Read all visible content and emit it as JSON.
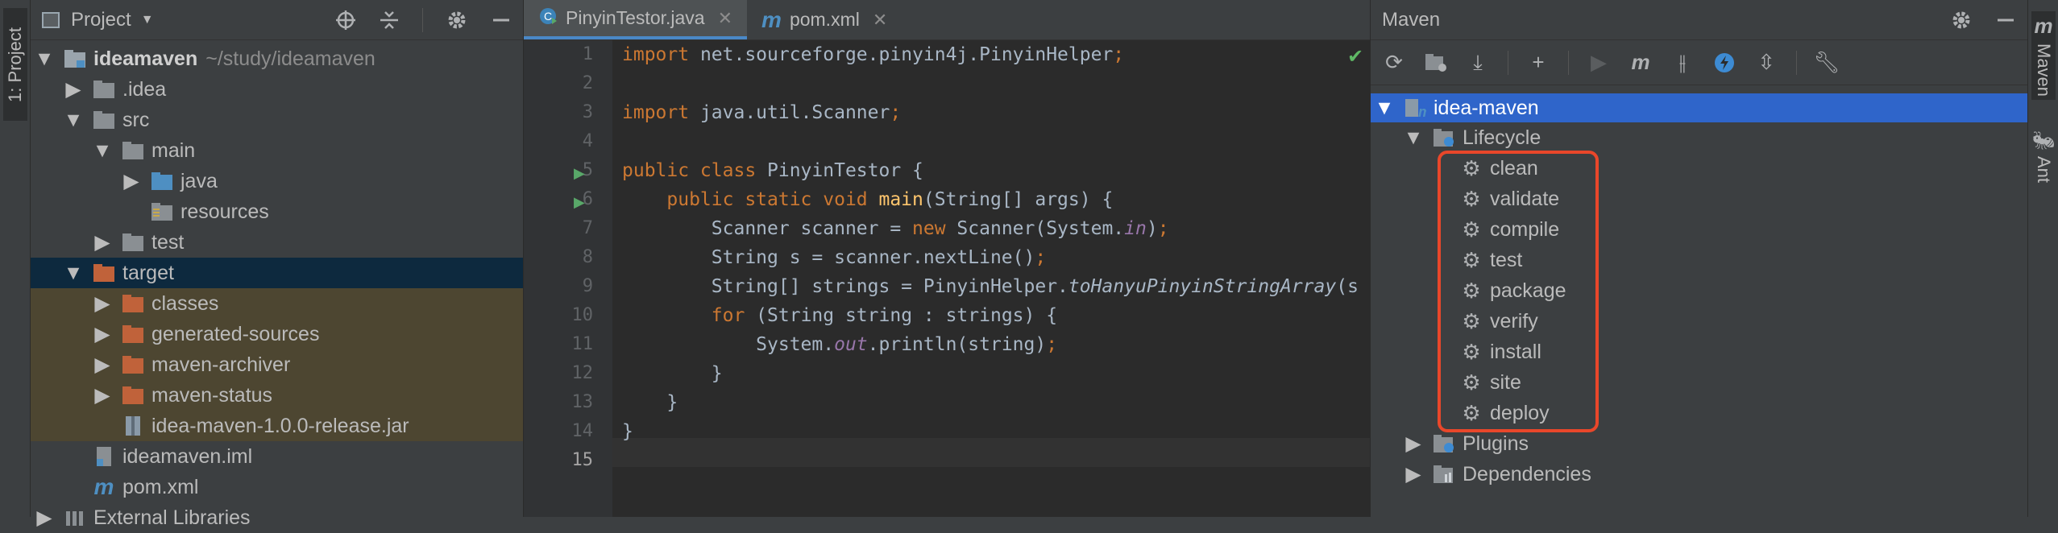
{
  "left_stripe": {
    "project_tab": "1: Project"
  },
  "right_stripe": {
    "maven_tab": "Maven",
    "ant_tab": "Ant"
  },
  "project": {
    "title": "Project",
    "tree": [
      {
        "label": "ideamaven",
        "suffix": "~/study/ideamaven"
      },
      {
        "label": ".idea"
      },
      {
        "label": "src"
      },
      {
        "label": "main"
      },
      {
        "label": "java"
      },
      {
        "label": "resources"
      },
      {
        "label": "test"
      },
      {
        "label": "target"
      },
      {
        "label": "classes"
      },
      {
        "label": "generated-sources"
      },
      {
        "label": "maven-archiver"
      },
      {
        "label": "maven-status"
      },
      {
        "label": "idea-maven-1.0.0-release.jar"
      },
      {
        "label": "ideamaven.iml"
      },
      {
        "label": "pom.xml"
      },
      {
        "label": "External Libraries"
      }
    ]
  },
  "editor": {
    "tabs": [
      {
        "label": "PinyinTestor.java",
        "active": true
      },
      {
        "label": "pom.xml",
        "active": false
      }
    ],
    "line_numbers": [
      "1",
      "2",
      "3",
      "4",
      "5",
      "6",
      "7",
      "8",
      "9",
      "10",
      "11",
      "12",
      "13",
      "14",
      "15"
    ],
    "code": {
      "l1_kw": "import",
      "l1_rest": " net.sourceforge.pinyin4j.PinyinHelper",
      "l1_semi": ";",
      "l3_kw": "import",
      "l3_rest": " java.util.Scanner",
      "l3_semi": ";",
      "l5_kw": "public class",
      "l5_rest": " PinyinTestor {",
      "l6_kw": "    public static void",
      "l6_fn": " main",
      "l6_rest": "(String[] args) {",
      "l7_a": "        Scanner scanner = ",
      "l7_kw": "new",
      "l7_b": " Scanner(System.",
      "l7_it": "in",
      "l7_c": ")",
      "l7_semi": ";",
      "l8_a": "        String s = scanner.nextLine()",
      "l8_semi": ";",
      "l9_a": "        String[] strings = PinyinHelper.",
      "l9_it": "toHanyuPinyinStringArray",
      "l9_b": "(s",
      "l10_kw": "        for",
      "l10_rest": " (String string : strings) {",
      "l11_a": "            System.",
      "l11_it": "out",
      "l11_b": ".println(string)",
      "l11_semi": ";",
      "l12": "        }",
      "l13": "    }",
      "l14": "}"
    }
  },
  "maven": {
    "title": "Maven",
    "root": "idea-maven",
    "lifecycle_label": "Lifecycle",
    "lifecycle": [
      "clean",
      "validate",
      "compile",
      "test",
      "package",
      "verify",
      "install",
      "site",
      "deploy"
    ],
    "plugins_label": "Plugins",
    "dependencies_label": "Dependencies"
  },
  "colors": {
    "selection": "#0d293e",
    "maven_selection": "#2f65ca",
    "highlight": "#e9472a",
    "folder": "#8a8f93",
    "target_folder": "#c0623a",
    "java_folder": "#4e8fc2"
  }
}
